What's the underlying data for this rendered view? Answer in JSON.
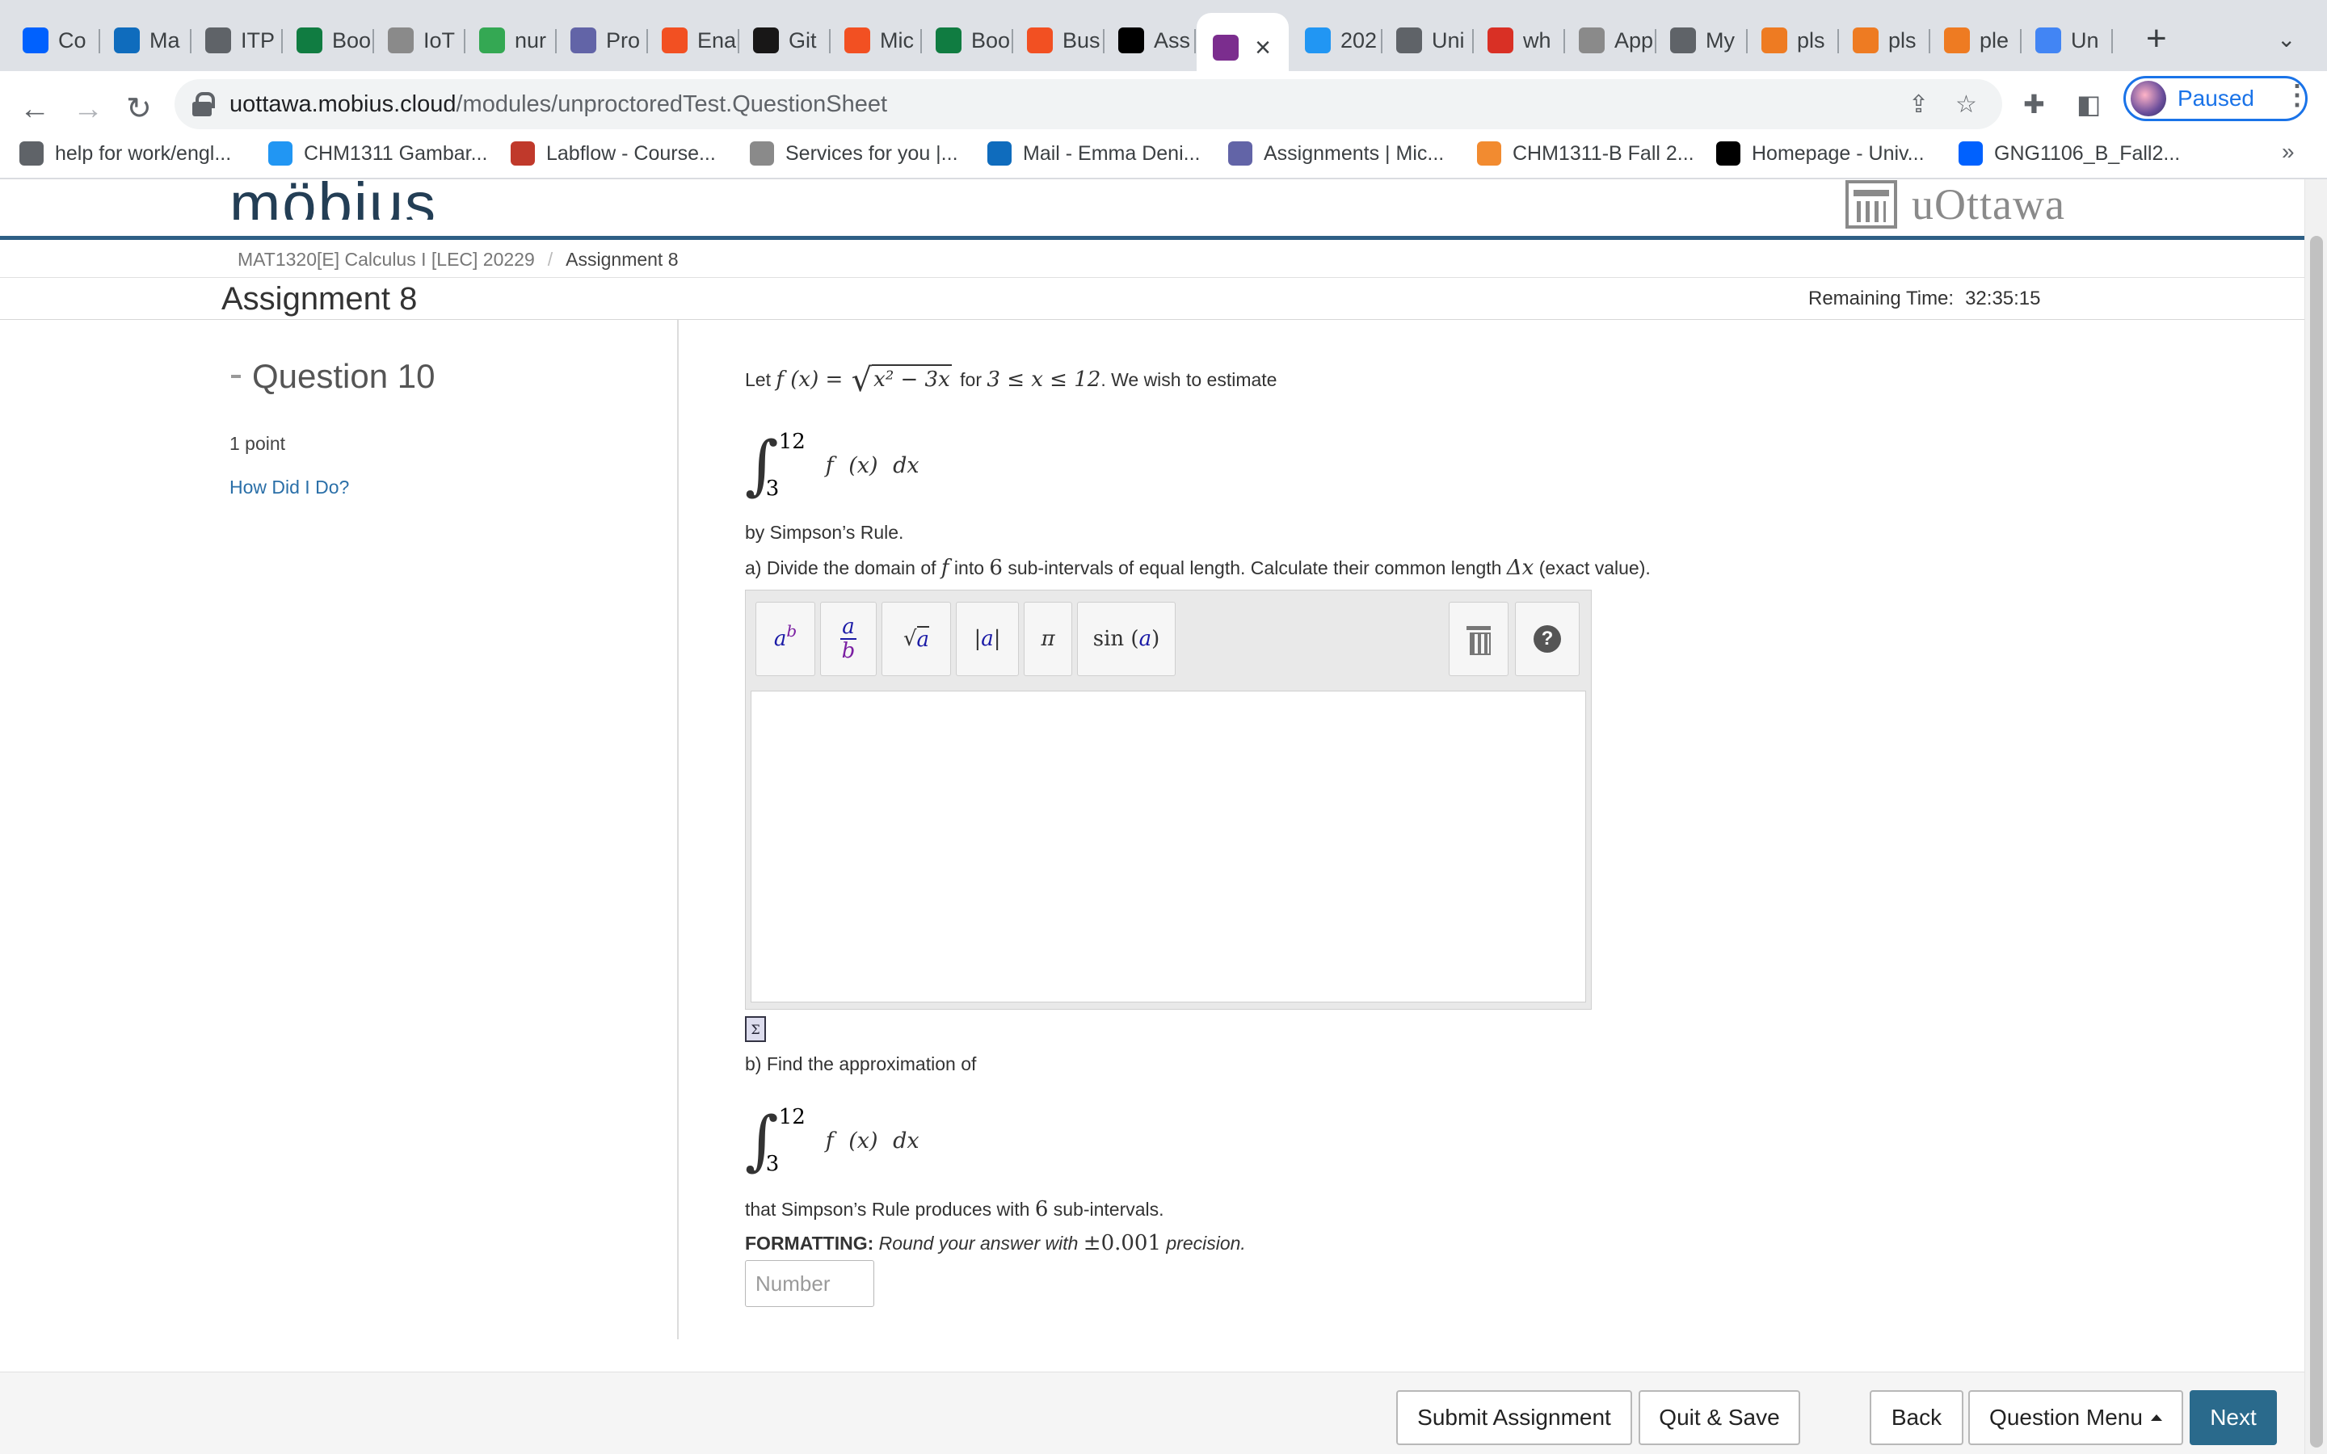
{
  "browser": {
    "tabs": [
      {
        "label": "Co",
        "icon": "dropbox-icon",
        "color": "#0061fe"
      },
      {
        "label": "Ma",
        "icon": "outlook-icon",
        "color": "#0f6cbd"
      },
      {
        "label": "ITP",
        "icon": "globe-icon",
        "color": "#5f6368"
      },
      {
        "label": "Boo",
        "icon": "excel-icon",
        "color": "#107c41"
      },
      {
        "label": "IoT",
        "icon": "iot-icon",
        "color": "#8a8a8a"
      },
      {
        "label": "nur",
        "icon": "plus-sheet-icon",
        "color": "#34a853"
      },
      {
        "label": "Pro",
        "icon": "teams-icon",
        "color": "#6264a7"
      },
      {
        "label": "Ena",
        "icon": "microsoft-icon",
        "color": "#f25022"
      },
      {
        "label": "Git",
        "icon": "github-icon",
        "color": "#181717"
      },
      {
        "label": "Mic",
        "icon": "microsoft-icon",
        "color": "#f25022"
      },
      {
        "label": "Boo",
        "icon": "excel-icon",
        "color": "#107c41"
      },
      {
        "label": "Bus",
        "icon": "microsoft-icon",
        "color": "#f25022"
      },
      {
        "label": "Ass",
        "icon": "d2l-icon",
        "color": "#000000"
      },
      {
        "label": "",
        "icon": "mobius-icon",
        "color": "#7b2d8e",
        "active": true
      },
      {
        "label": "202",
        "icon": "wp-icon",
        "color": "#2196f3"
      },
      {
        "label": "Uni",
        "icon": "institution-icon",
        "color": "#5f6368"
      },
      {
        "label": "wh",
        "icon": "gmail-icon",
        "color": "#d93025"
      },
      {
        "label": "App",
        "icon": "institution-icon",
        "color": "#8a8a8a"
      },
      {
        "label": "My",
        "icon": "globe-icon",
        "color": "#5f6368"
      },
      {
        "label": "pls",
        "icon": "c-orange-icon",
        "color": "#ee7b22"
      },
      {
        "label": "pls",
        "icon": "c-orange-icon",
        "color": "#ee7b22"
      },
      {
        "label": "ple",
        "icon": "c-orange-icon",
        "color": "#ee7b22"
      },
      {
        "label": "Un",
        "icon": "docs-icon",
        "color": "#4285f4"
      }
    ],
    "url_host": "uottawa.mobius.cloud",
    "url_path": "/modules/unproctoredTest.QuestionSheet",
    "profile_label": "Paused",
    "bookmarks": [
      {
        "label": "help for work/engl...",
        "icon": "folder-icon",
        "color": "#5f6368"
      },
      {
        "label": "CHM1311 Gambar...",
        "icon": "wp-icon",
        "color": "#2196f3"
      },
      {
        "label": "Labflow - Course...",
        "icon": "flask-icon",
        "color": "#c0392b"
      },
      {
        "label": "Services for you |...",
        "icon": "institution-icon",
        "color": "#8a8a8a"
      },
      {
        "label": "Mail - Emma Deni...",
        "icon": "outlook-icon",
        "color": "#0f6cbd"
      },
      {
        "label": "Assignments | Mic...",
        "icon": "teams-icon",
        "color": "#6264a7"
      },
      {
        "label": "CHM1311-B Fall 2...",
        "icon": "swirl-icon",
        "color": "#f28b30"
      },
      {
        "label": "Homepage - Univ...",
        "icon": "d2l-icon",
        "color": "#000000"
      },
      {
        "label": "GNG1106_B_Fall2...",
        "icon": "dropbox-icon",
        "color": "#0061fe"
      }
    ]
  },
  "site": {
    "logo_text": "möbius",
    "institution": "uOttawa",
    "brand_color": "#2e5f85"
  },
  "breadcrumb": {
    "course": "MAT1320[E] Calculus I [LEC] 20229",
    "separator": "/",
    "current": "Assignment 8"
  },
  "header": {
    "title": "Assignment 8",
    "remaining_label": "Remaining Time:",
    "remaining_value": "32:35:15"
  },
  "sidebar": {
    "question_title": "Question 10",
    "points": "1 point",
    "how_link": "How Did I Do?"
  },
  "question": {
    "intro_let": "Let",
    "intro_fx": "f (x) =",
    "radicand": "x² − 3x",
    "intro_for": "for",
    "domain": "3 ≤ x ≤ 12",
    "intro_end": ". We wish to estimate",
    "integral_upper": "12",
    "integral_lower": "3",
    "integrand": "f (x) dx",
    "by_rule": "by Simpson’s Rule.",
    "part_a_1": "a) Divide the domain of",
    "part_a_f": "f",
    "part_a_2": "into",
    "part_a_n": "6",
    "part_a_3": "sub-intervals of equal length. Calculate their common length",
    "part_a_dx": "Δx",
    "part_a_4": "(exact value).",
    "part_b": "b) Find the approximation of",
    "part_b_tail_1": "that Simpson’s Rule produces with",
    "part_b_n": "6",
    "part_b_tail_2": "sub-intervals.",
    "formatting_label": "FORMATTING:",
    "formatting_text_1": "Round your answer with",
    "formatting_precision": "±0.001",
    "formatting_text_2": "precision.",
    "answer_placeholder": "Number"
  },
  "editor_palette": [
    {
      "name": "power-button"
    },
    {
      "name": "fraction-button"
    },
    {
      "name": "sqrt-button"
    },
    {
      "name": "abs-button"
    },
    {
      "name": "pi-button",
      "label": "π"
    },
    {
      "name": "sin-button",
      "label": "sin"
    }
  ],
  "footer": {
    "submit": "Submit Assignment",
    "quit_save": "Quit & Save",
    "back": "Back",
    "question_menu": "Question Menu",
    "next": "Next",
    "next_color": "#2a6a8c"
  }
}
